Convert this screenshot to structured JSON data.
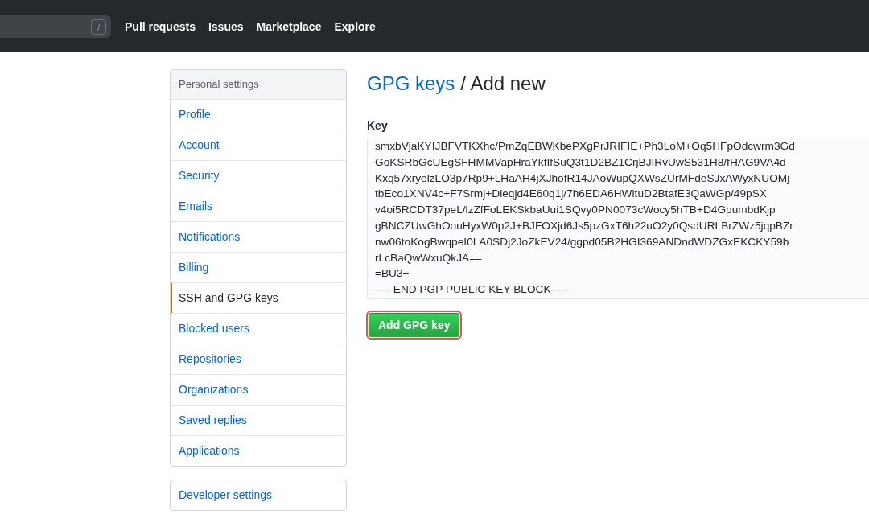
{
  "header": {
    "search": {
      "shortcut": "/"
    },
    "nav": [
      "Pull requests",
      "Issues",
      "Marketplace",
      "Explore"
    ]
  },
  "sidebar": {
    "title": "Personal settings",
    "items": [
      {
        "label": "Profile",
        "selected": false
      },
      {
        "label": "Account",
        "selected": false
      },
      {
        "label": "Security",
        "selected": false
      },
      {
        "label": "Emails",
        "selected": false
      },
      {
        "label": "Notifications",
        "selected": false
      },
      {
        "label": "Billing",
        "selected": false
      },
      {
        "label": "SSH and GPG keys",
        "selected": true
      },
      {
        "label": "Blocked users",
        "selected": false
      },
      {
        "label": "Repositories",
        "selected": false
      },
      {
        "label": "Organizations",
        "selected": false
      },
      {
        "label": "Saved replies",
        "selected": false
      },
      {
        "label": "Applications",
        "selected": false
      }
    ],
    "developer_settings": "Developer settings"
  },
  "page": {
    "breadcrumb_link": "GPG keys",
    "separator": "/",
    "title": "Add new"
  },
  "key_field": {
    "label": "Key",
    "value": "smxbVjaKYIJBFVTKXhc/PmZqEBWKbePXgPrJRIFIE+Ph3LoM+Oq5HFpOdcwrm3Gd\nGoKSRbGcUEgSFHMMVapHraYkfIfSuQ3t1D2BZ1CrjBJIRvUwS531H8/fHAG9VA4d\nKxq57xryelzLO3p7Rp9+LHaAH4jXJhofR14JAoWupQXWsZUrMFdeSJxAWyxNUOMj\ntbEco1XNV4c+F7Srmj+Dleqjd4E60q1j/7h6EDA6HWltuD2BtafE3QaWGp/49pSX\nv4oi5RCDT37peL/lzZfFoLEKSkbaUui1SQvy0PN0073cWocy5hTB+D4GpumbdKjp\ngBNCZUwGhOouHyxW0p2J+BJFOXjd6Js5pzGxT6h22uO2y0QsdURLBrZWz5jqpBZr\nnw06toKogBwqpeI0LA0SDj2JoZkEV24/ggpd05B2HGI369ANDndWDZGxEKCKY59b\nrLcBaQwWxuQkJA==\n=BU3+\n-----END PGP PUBLIC KEY BLOCK-----"
  },
  "submit": {
    "label": "Add GPG key",
    "highlighted": true
  }
}
